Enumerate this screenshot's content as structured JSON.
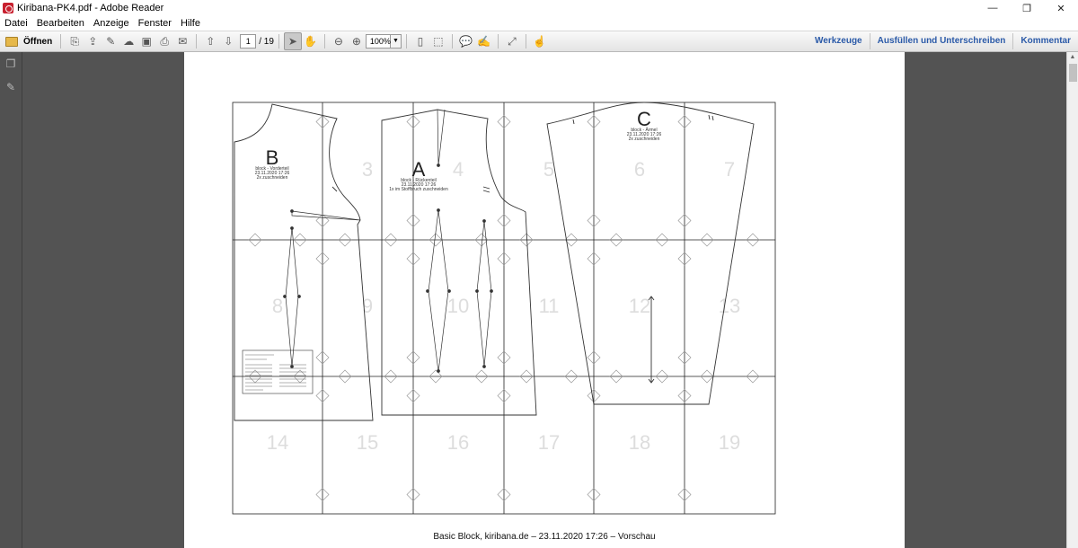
{
  "window": {
    "title": "Kiribana-PK4.pdf - Adobe Reader",
    "minimize": "—",
    "maximize": "❐",
    "close": "✕"
  },
  "menu": [
    "Datei",
    "Bearbeiten",
    "Anzeige",
    "Fenster",
    "Hilfe"
  ],
  "toolbar": {
    "open_label": "Öffnen",
    "page_current": "1",
    "page_total": "/ 19",
    "zoom": "100%",
    "right_links": [
      "Werkzeuge",
      "Ausfüllen und Unterschreiben",
      "Kommentar"
    ]
  },
  "document": {
    "page_numbers": [
      "3",
      "4",
      "5",
      "6",
      "7",
      "8",
      "9",
      "10",
      "11",
      "12",
      "13",
      "14",
      "15",
      "16",
      "17",
      "18",
      "19"
    ],
    "pieces": {
      "B": {
        "letter": "B",
        "lines": [
          "block - Vorderteil",
          "23.11.2020 17:26",
          "2x zuschneiden"
        ]
      },
      "A": {
        "letter": "A",
        "lines": [
          "block - Rückenteil",
          "23.11.2020 17:26",
          "1x im Stoffbruch zuschneiden"
        ]
      },
      "C": {
        "letter": "C",
        "lines": [
          "block - Ärmel",
          "23.11.2020 17:26",
          "2x zuschneiden"
        ]
      }
    },
    "footer": "Basic Block, kiribana.de – 23.11.2020 17:26 – Vorschau"
  }
}
